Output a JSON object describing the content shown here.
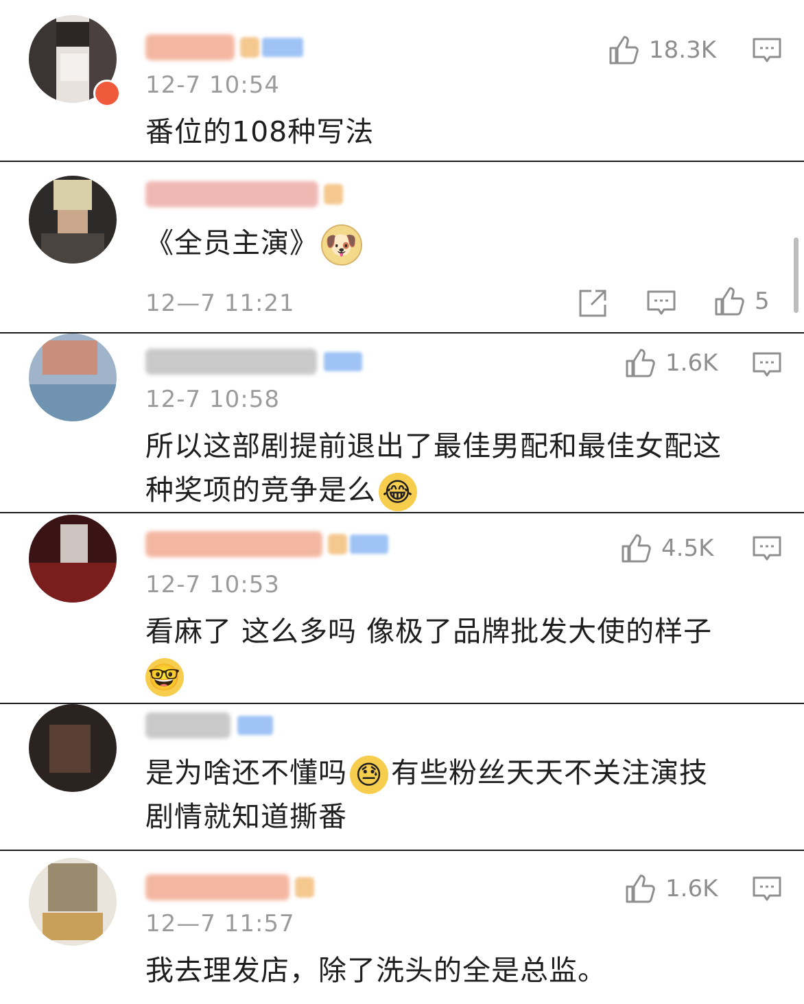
{
  "comments": [
    {
      "time": "12-7 10:54",
      "likes": "18.3K",
      "text": "番位的108种写法",
      "name_color": "#f3b7a1"
    },
    {
      "time": "12—7 11:21",
      "likes": "5",
      "text": "《全员主演》",
      "emoji": "doge-emoji",
      "name_color": "#f0b8b3"
    },
    {
      "time": "12-7 10:58",
      "likes": "1.6K",
      "text_line1": "所以这部剧提前退出了最佳男配和最佳女配这",
      "text_line2": "种奖项的竞争是么",
      "emoji": "laugh-cry-emoji",
      "name_color": "#c9c9c9"
    },
    {
      "time": "12-7 10:53",
      "likes": "4.5K",
      "text_line1": "看麻了 这么多吗 像极了品牌批发大使的样子",
      "emoji": "nerd-emoji",
      "name_color": "#f3b7a1"
    },
    {
      "time": "",
      "likes": "",
      "text_line1a": "是为啥还不懂吗",
      "text_line1b": "有些粉丝天天不关注演技",
      "text_line2": "剧情就知道撕番",
      "emoji": "sweat-emoji",
      "name_color": "#c9c9c9"
    },
    {
      "time": "12—7 11:57",
      "likes": "1.6K",
      "text": "我去理发店，除了洗头的全是总监。",
      "name_color": "#f3b7a1"
    }
  ],
  "colors": {
    "gray_text": "#9b9b9b",
    "icon_gray": "#8e8e8e",
    "border": "#1a1a1a"
  }
}
